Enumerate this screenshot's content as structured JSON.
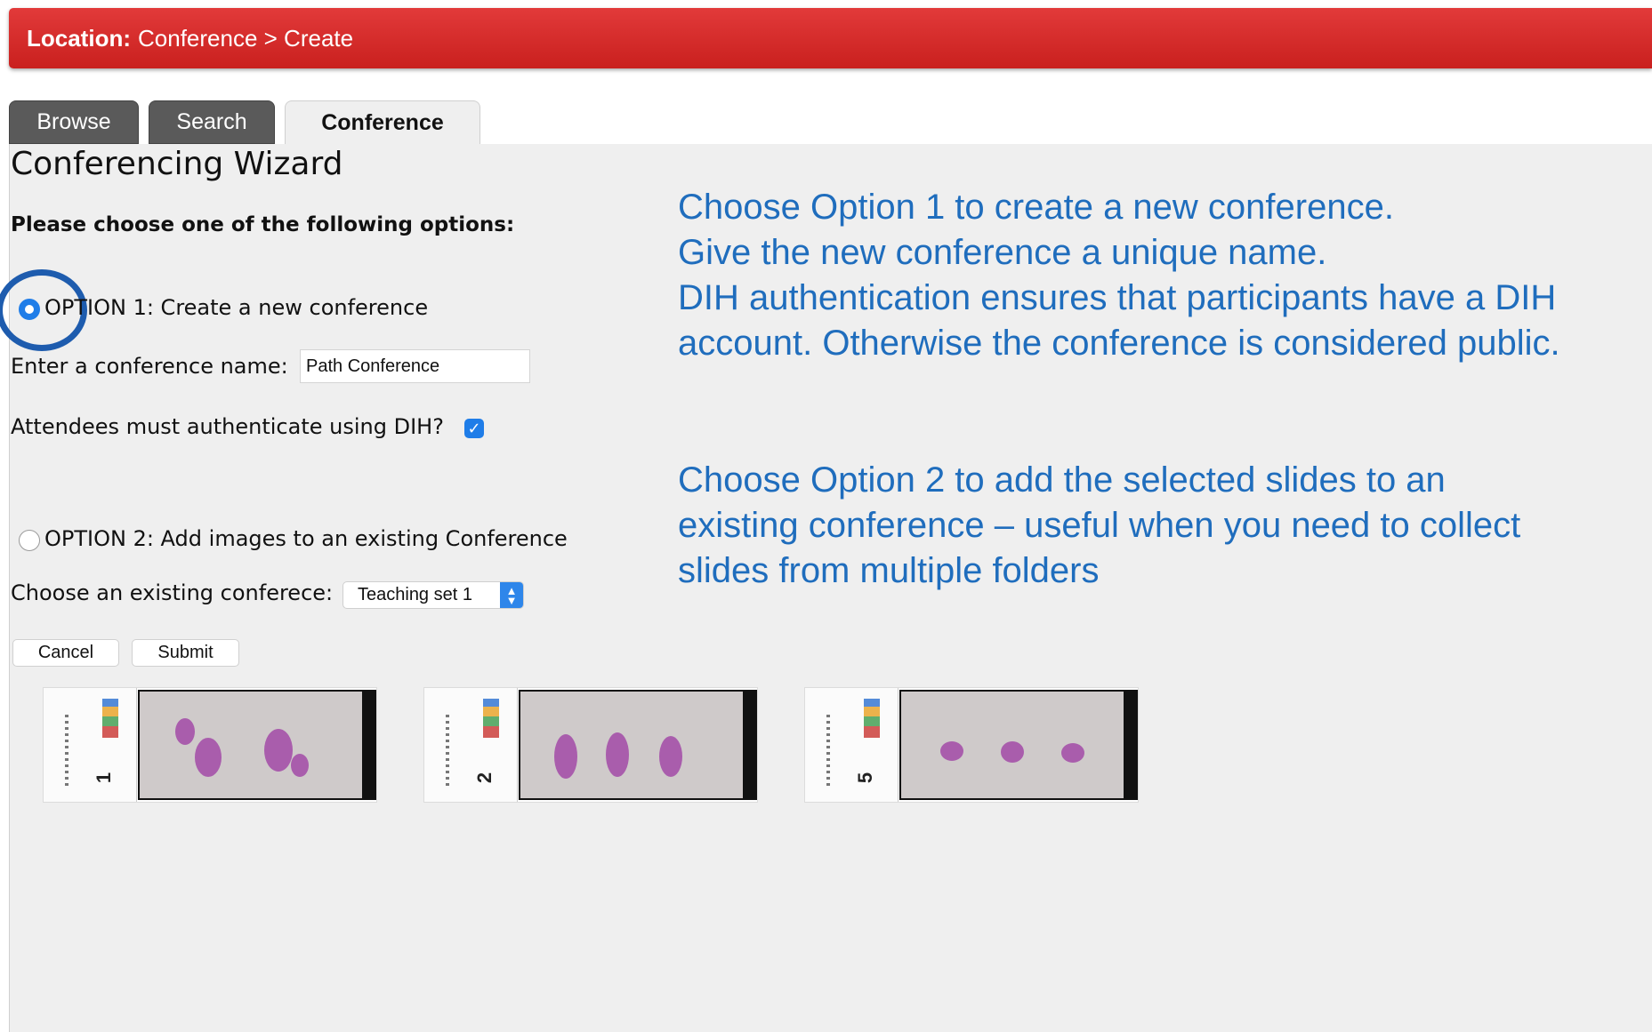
{
  "location": {
    "label": "Location:",
    "path": "Conference > Create"
  },
  "tabs": [
    {
      "label": "Browse"
    },
    {
      "label": "Search"
    },
    {
      "label": "Conference"
    }
  ],
  "wizard": {
    "title": "Conferencing Wizard",
    "prompt": "Please choose one of the following options:",
    "option1": {
      "label": "OPTION 1: Create a new conference",
      "selected": true,
      "name_label": "Enter a conference name:",
      "name_value": "Path Conference",
      "auth_label": "Attendees must authenticate using DIH?",
      "auth_checked": true
    },
    "option2": {
      "label": "OPTION 2: Add images to an existing Conference",
      "selected": false,
      "choose_label": "Choose an existing conferece:",
      "selected_value": "Teaching set 1"
    },
    "buttons": {
      "cancel": "Cancel",
      "submit": "Submit"
    }
  },
  "annotations": {
    "note1": "Choose Option 1 to create a new conference.\nGive the new conference a unique name.\nDIH authentication ensures that participants have a DIH\naccount. Otherwise the conference is considered public.",
    "note2": "Choose Option 2 to add the selected slides to an\nexisting conference – useful when you need to collect\nslides from multiple folders"
  },
  "slides": [
    {
      "number": "1"
    },
    {
      "number": "2"
    },
    {
      "number": "5"
    }
  ],
  "colors": {
    "location_bar": "#d42c2a",
    "annotation_text": "#1f6dbd",
    "highlight_ring": "#1e5cae",
    "accent": "#1f7de8"
  }
}
